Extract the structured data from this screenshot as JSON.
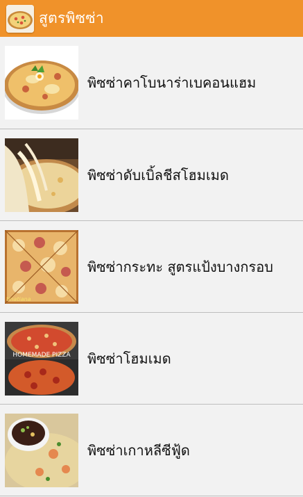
{
  "app": {
    "title": "สูตรพิซซ่า",
    "icon": "pizza-icon",
    "colors": {
      "appbar": "#f0922a",
      "background": "#f2f2f2",
      "divider": "#bdbdbd"
    }
  },
  "recipes": [
    {
      "label": "พิซซ่าคาโบนาร่าเบคอนแฮม",
      "thumbnail": "pizza-carbonara-image"
    },
    {
      "label": "พิซซ่าดับเบิ้ลชีสโฮมเมด",
      "thumbnail": "double-cheese-pizza-image"
    },
    {
      "label": "พิซซ่ากระทะ สูตรแป้งบางกรอบ",
      "thumbnail": "pan-pizza-image",
      "watermark": "tinatiana"
    },
    {
      "label": "พิซซ่าโฮมเมด",
      "thumbnail": "homemade-pizza-image",
      "caption": "HOMEMADE PIZZA"
    },
    {
      "label": "พิซซ่าเกาหลีซีฟู้ด",
      "thumbnail": "korean-seafood-pizza-image"
    }
  ]
}
